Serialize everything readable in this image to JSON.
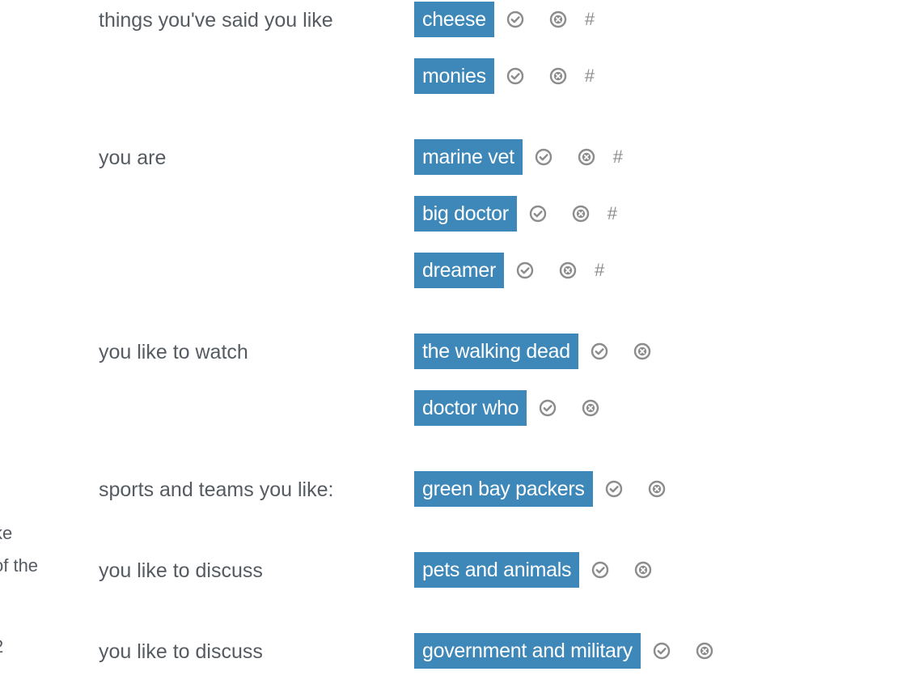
{
  "edge_text": [
    "ke",
    "of the",
    "2"
  ],
  "sections": [
    {
      "label": "things you've said you like",
      "tags": [
        "cheese",
        "monies"
      ],
      "hash_symbol": "#"
    },
    {
      "label": "you are",
      "tags": [
        "marine vet",
        "big doctor",
        "dreamer"
      ],
      "hash_symbol": "#"
    },
    {
      "label": "you like to watch",
      "tags": [
        "the walking dead",
        "doctor who"
      ]
    },
    {
      "label": "sports and teams you like:",
      "tags": [
        "green bay packers"
      ]
    },
    {
      "label": "you like to discuss",
      "tags": [
        "pets and animals"
      ]
    },
    {
      "label": "you like to discuss",
      "tags": [
        "government and military"
      ]
    }
  ],
  "colors": {
    "tag_background": "#3d87b9",
    "tag_text": "#ffffff",
    "label_text": "#555b61",
    "icon_gray": "#8c8c8c"
  },
  "icons": {
    "confirm": "check-circle-icon",
    "remove": "x-circle-icon"
  }
}
